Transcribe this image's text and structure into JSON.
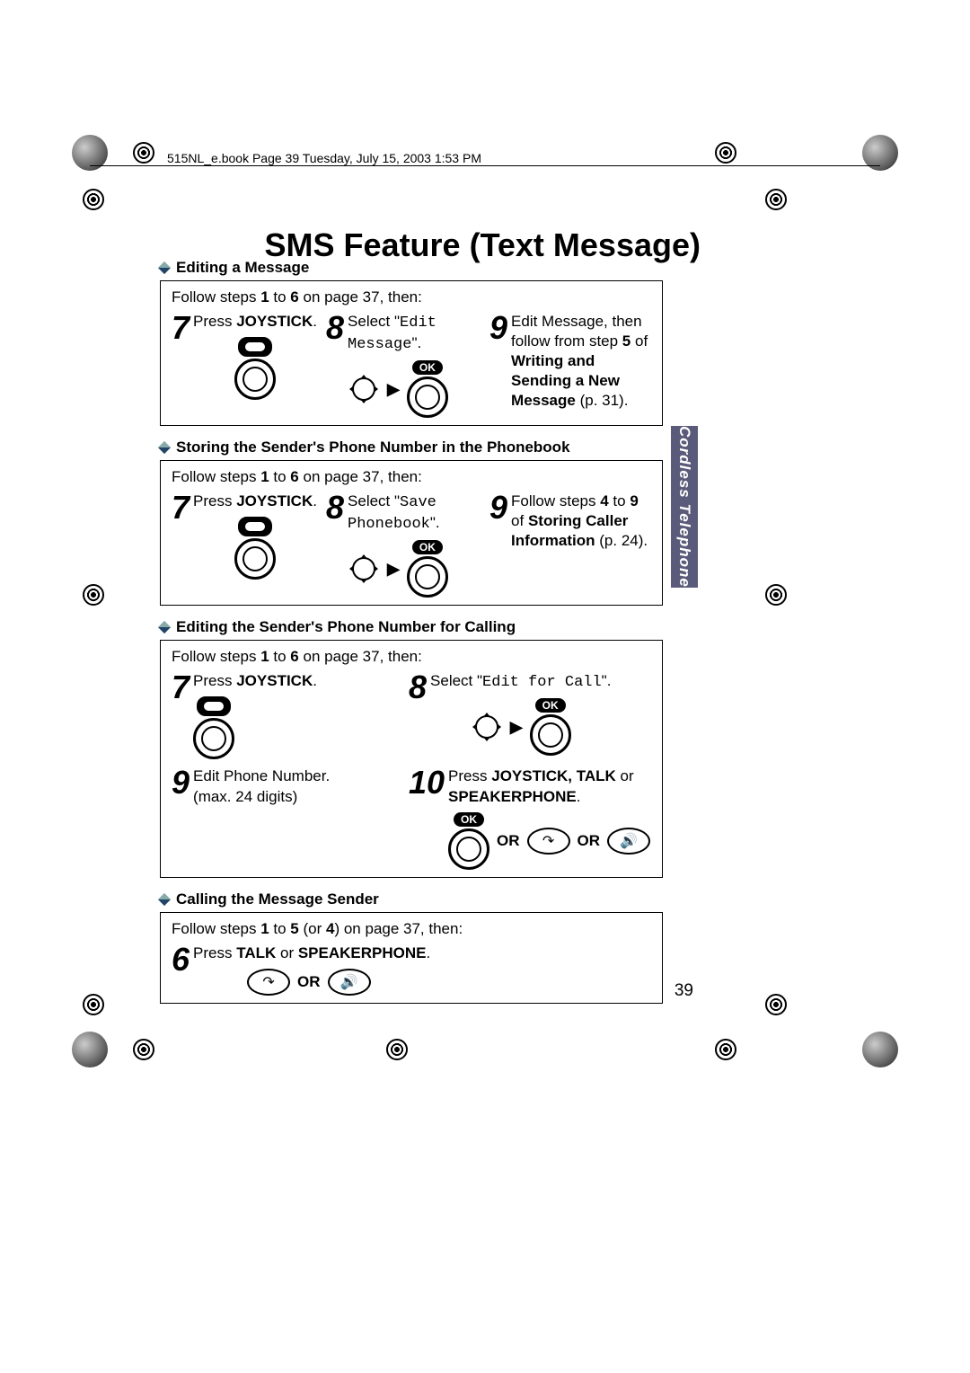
{
  "header_line": "515NL_e.book  Page 39  Tuesday, July 15, 2003  1:53 PM",
  "title": "SMS Feature (Text Message)",
  "side_tab": "Cordless Telephone",
  "page_number": "39",
  "sections": {
    "edit": {
      "title": "Editing a Message",
      "intro_a": "Follow steps ",
      "intro_b": "1",
      "intro_c": " to ",
      "intro_d": "6",
      "intro_e": " on page 37, then:",
      "s7_a": "Press ",
      "s7_b": "JOYSTICK",
      "s7_c": ".",
      "s8_a": "Select \"",
      "s8_b": "Edit Message",
      "s8_c": "\".",
      "s9_a": "Edit Message, then follow from step ",
      "s9_b": "5",
      "s9_c": " of ",
      "s9_d": "Writing and Sending a New Message",
      "s9_e": " (p. 31)."
    },
    "store": {
      "title": "Storing the Sender's Phone Number in the Phonebook",
      "intro_a": "Follow steps ",
      "intro_b": "1",
      "intro_c": " to ",
      "intro_d": "6",
      "intro_e": " on page 37, then:",
      "s7_a": "Press ",
      "s7_b": "JOYSTICK",
      "s7_c": ".",
      "s8_a": "Select \"",
      "s8_b": "Save Phonebook",
      "s8_c": "\".",
      "s9_a": "Follow steps ",
      "s9_b": "4",
      "s9_c": " to ",
      "s9_d": "9",
      "s9_e": " of ",
      "s9_f": "Storing Caller Information",
      "s9_g": " (p. 24)."
    },
    "editcall": {
      "title": "Editing the Sender's Phone Number for Calling",
      "intro_a": "Follow steps ",
      "intro_b": "1",
      "intro_c": " to ",
      "intro_d": "6",
      "intro_e": " on page 37, then:",
      "s7_a": "Press ",
      "s7_b": "JOYSTICK",
      "s7_c": ".",
      "s8_a": "Select \"",
      "s8_b": "Edit for Call",
      "s8_c": "\".",
      "s9_a": "Edit Phone Number.",
      "s9_b": "(max. 24 digits)",
      "s10_a": "Press ",
      "s10_b": "JOYSTICK, TALK",
      "s10_c": " or ",
      "s10_d": "SPEAKERPHONE",
      "s10_e": "."
    },
    "call": {
      "title": "Calling the Message Sender",
      "intro_a": "Follow steps ",
      "intro_b": "1",
      "intro_c": " to ",
      "intro_d": "5",
      "intro_e": " (or ",
      "intro_f": "4",
      "intro_g": ") on page 37, then:",
      "s6_a": "Press ",
      "s6_b": "TALK",
      "s6_c": " or ",
      "s6_d": "SPEAKERPHONE",
      "s6_e": "."
    }
  },
  "labels": {
    "ok": "OK",
    "or": "OR",
    "num6": "6",
    "num7": "7",
    "num8": "8",
    "num9": "9",
    "num10": "10"
  }
}
